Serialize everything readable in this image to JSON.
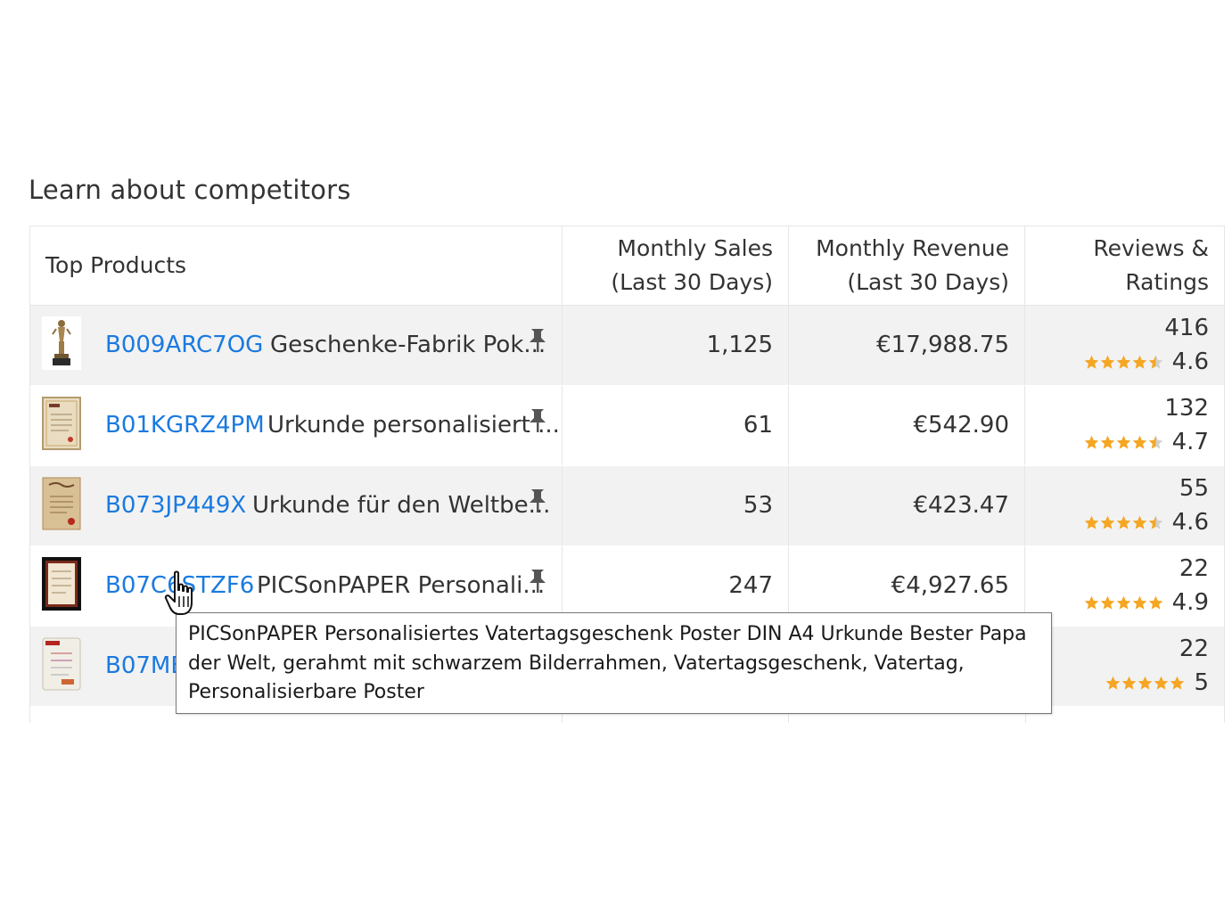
{
  "section_title": "Learn about competitors",
  "table": {
    "headers": {
      "products": "Top Products",
      "sales_line1": "Monthly Sales",
      "sales_line2": "(Last 30 Days)",
      "revenue_line1": "Monthly Revenue",
      "revenue_line2": "(Last 30 Days)",
      "reviews_line1": "Reviews &",
      "reviews_line2": "Ratings"
    },
    "rows": [
      {
        "asin": "B009ARC7OG",
        "title": "Geschenke-Fabrik Pok...",
        "sales": "1,125",
        "revenue": "€17,988.75",
        "reviews": "416",
        "rating": "4.6",
        "stars_filled": 4.5,
        "thumb": "trophy"
      },
      {
        "asin": "B01KGRZ4PM",
        "title": "Urkunde personalisiert ...",
        "sales": "61",
        "revenue": "€542.90",
        "reviews": "132",
        "rating": "4.7",
        "stars_filled": 4.5,
        "thumb": "certificate"
      },
      {
        "asin": "B073JP449X",
        "title": "Urkunde für den Weltbe...",
        "sales": "53",
        "revenue": "€423.47",
        "reviews": "55",
        "rating": "4.6",
        "stars_filled": 4.5,
        "thumb": "parchment"
      },
      {
        "asin": "B07C6STZF6",
        "title": "PICSonPAPER Personali...",
        "sales": "247",
        "revenue": "€4,927.65",
        "reviews": "22",
        "rating": "4.9",
        "stars_filled": 5,
        "thumb": "framed-poster"
      },
      {
        "asin": "B07ME",
        "title": "",
        "sales": "",
        "revenue": "",
        "reviews": "22",
        "rating": "5",
        "stars_filled": 5,
        "thumb": "certificate-small"
      }
    ]
  },
  "tooltip": {
    "text": "PICSonPAPER Personalisiertes Vatertagsgeschenk Poster DIN A4 Urkunde Bester Papa der Welt, gerahmt mit schwarzem Bilderrahmen, Vatertagsgeschenk, Vatertag, Personalisierbare Poster"
  },
  "icons": {
    "pin": "pin-icon",
    "star": "star-icon",
    "cursor": "hand-pointer-cursor-icon"
  },
  "colors": {
    "link": "#1a7ae0",
    "star": "#f5a623",
    "odd_row": "#f2f2f2",
    "pin": "#555555"
  }
}
